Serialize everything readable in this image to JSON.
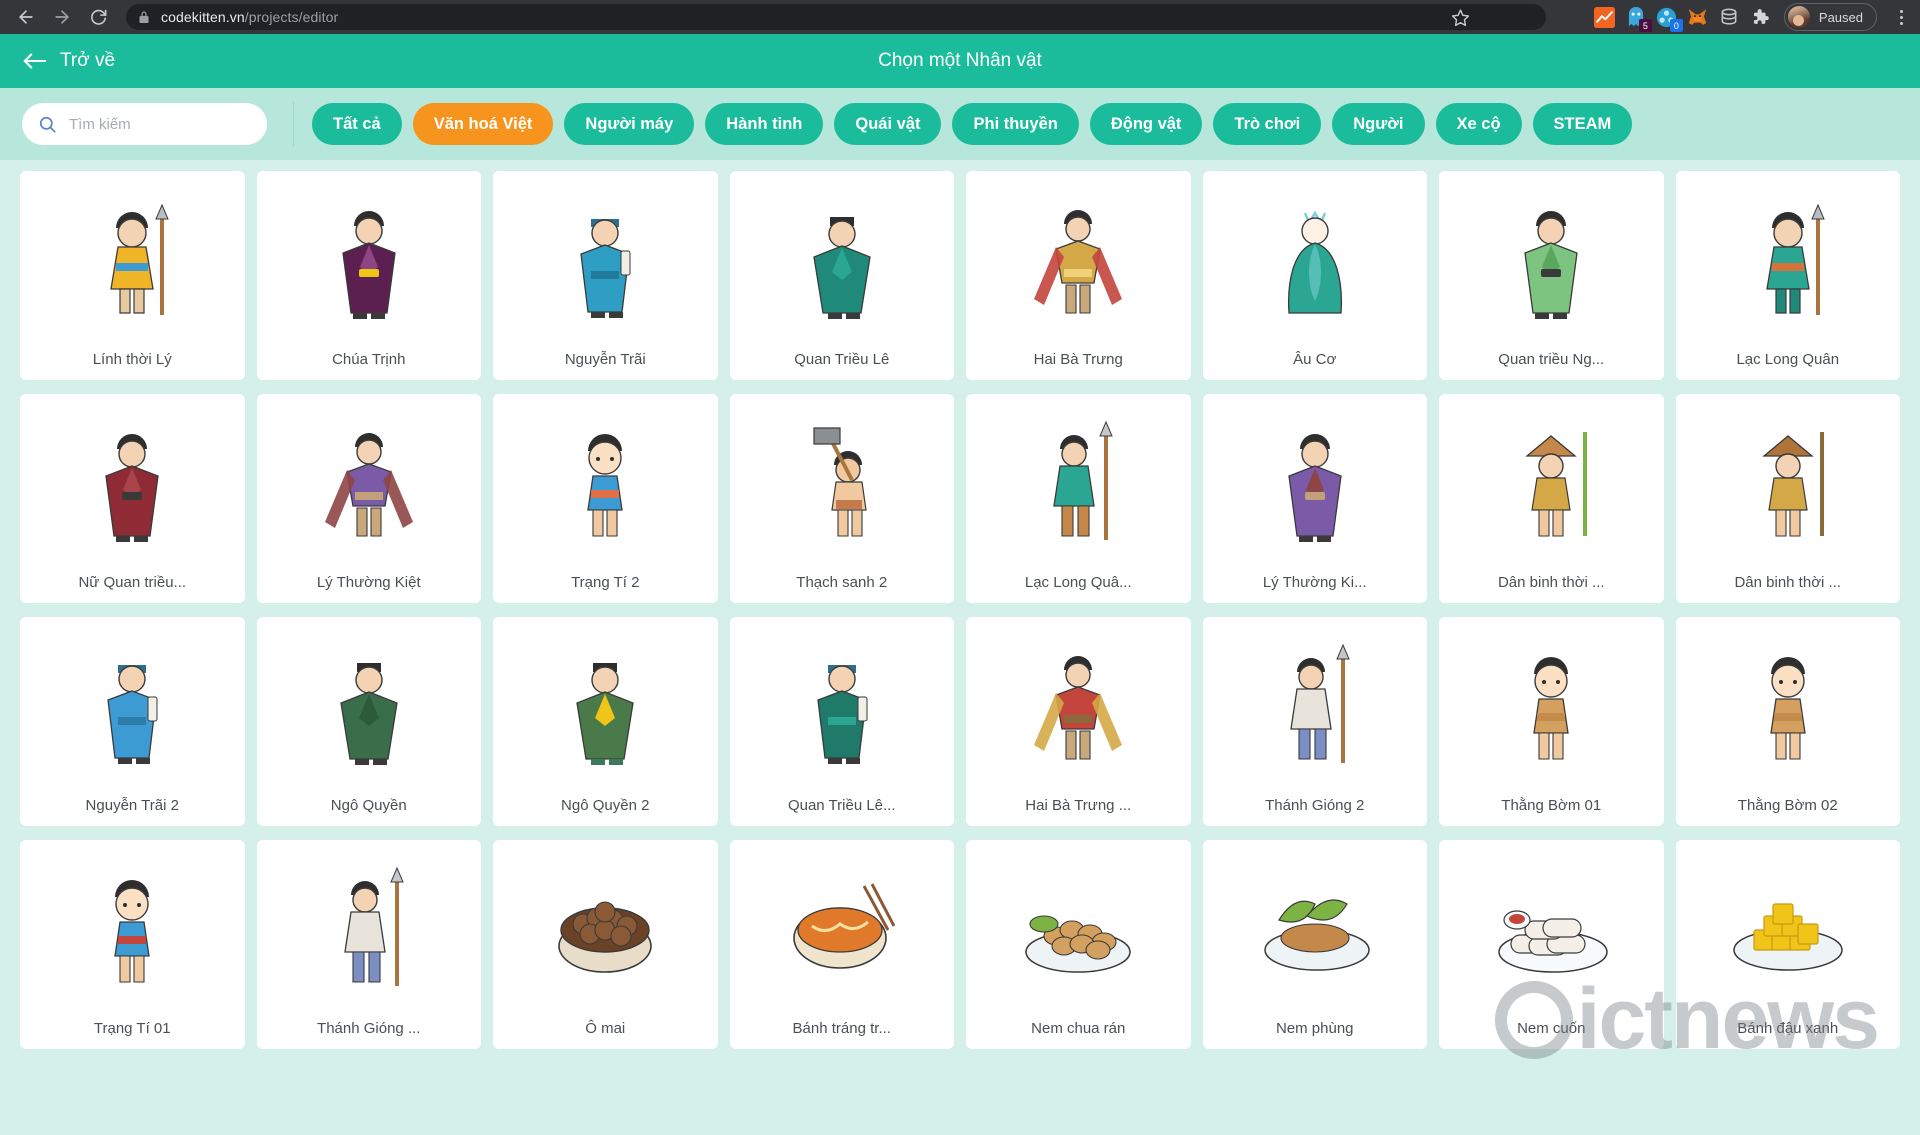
{
  "browser": {
    "url_host": "codekitten.vn",
    "url_path": "/projects/editor",
    "back_icon": "back-arrow-icon",
    "forward_icon": "forward-arrow-icon",
    "reload_icon": "reload-icon",
    "lock_icon": "lock-icon",
    "star_icon": "bookmark-star-icon",
    "profile_label": "Paused",
    "extensions": [
      {
        "name": "analytics-extension-icon",
        "badge": "",
        "color": "#f26522"
      },
      {
        "name": "ghostery-extension-icon",
        "badge": "5",
        "color": "#3aa7dd",
        "badge_color": "#4a0e3f"
      },
      {
        "name": "puzzle-blue-extension-icon",
        "badge": "0",
        "color": "#2a9fd6",
        "badge_color": "#1a73e8"
      },
      {
        "name": "metamask-fox-extension-icon",
        "badge": "",
        "color": "#e2761b"
      },
      {
        "name": "database-extension-icon",
        "badge": "",
        "color": "#b8bcc0"
      },
      {
        "name": "extensions-puzzle-icon",
        "badge": "",
        "color": "#d4d7da"
      }
    ],
    "menu_icon": "three-dot-menu-icon"
  },
  "header": {
    "back_label": "Trở về",
    "back_icon": "arrow-left-icon",
    "title": "Chọn một Nhân vật"
  },
  "toolbar": {
    "search_placeholder": "Tìm kiếm",
    "search_value": "",
    "search_icon": "search-icon",
    "chips": [
      {
        "label": "Tất cả",
        "active": false
      },
      {
        "label": "Văn hoá Việt",
        "active": true
      },
      {
        "label": "Người máy",
        "active": false
      },
      {
        "label": "Hành tinh",
        "active": false
      },
      {
        "label": "Quái vật",
        "active": false
      },
      {
        "label": "Phi thuyền",
        "active": false
      },
      {
        "label": "Động vật",
        "active": false
      },
      {
        "label": "Trò chơi",
        "active": false
      },
      {
        "label": "Người",
        "active": false
      },
      {
        "label": "Xe cộ",
        "active": false
      },
      {
        "label": "STEAM",
        "active": false
      }
    ]
  },
  "colors": {
    "accent_teal": "#1bbc9b",
    "accent_orange": "#f7941e",
    "toolbar_bg": "#b7e6da",
    "page_bg": "#d4f0e8",
    "card_bg": "#ffffff"
  },
  "watermark": "ictnews",
  "grid": {
    "cards": [
      {
        "label": "Lính thời Lý",
        "art": "soldier",
        "c1": "#f0b429",
        "c2": "#3d9bd4",
        "c3": "#e8c9a0"
      },
      {
        "label": "Chúa Trịnh",
        "art": "robe",
        "c1": "#5b2050",
        "c2": "#8e4585",
        "c3": "#f0c419"
      },
      {
        "label": "Nguyễn Trãi",
        "art": "scholar",
        "c1": "#2e9ec4",
        "c2": "#1f7a9c",
        "c3": "#e8c9a0"
      },
      {
        "label": "Quan Triều Lê",
        "art": "official",
        "c1": "#1f8a7a",
        "c2": "#2aa693",
        "c3": "#3a3a3a"
      },
      {
        "label": "Hai Bà Trưng",
        "art": "warrior",
        "c1": "#d4a847",
        "c2": "#c4453c",
        "c3": "#f0d27a"
      },
      {
        "label": "Âu Cơ",
        "art": "queen",
        "c1": "#2aa693",
        "c2": "#1f8a7a",
        "c3": "#7ecfd4"
      },
      {
        "label": "Quan triều Ng...",
        "art": "robe",
        "c1": "#7cc47f",
        "c2": "#5aa85f",
        "c3": "#3a3a3a"
      },
      {
        "label": "Lạc Long Quân",
        "art": "soldier",
        "c1": "#2aa693",
        "c2": "#d4733a",
        "c3": "#1f8a7a"
      },
      {
        "label": "Nữ Quan triều...",
        "art": "robe",
        "c1": "#8e2b34",
        "c2": "#a8444c",
        "c3": "#3a3a3a"
      },
      {
        "label": "Lý Thường Kiệt",
        "art": "warrior",
        "c1": "#7b5ba8",
        "c2": "#8e4545",
        "c3": "#c4a07a"
      },
      {
        "label": "Trạng Tí 2",
        "art": "boy",
        "c1": "#3d9bd4",
        "c2": "#e0704a",
        "c3": "#f0c9a0"
      },
      {
        "label": "Thạch sanh 2",
        "art": "axe",
        "c1": "#c47a4a",
        "c2": "#8a8f94",
        "c3": "#f0c9a0"
      },
      {
        "label": "Lạc Long Quâ...",
        "art": "spear",
        "c1": "#2aa693",
        "c2": "#c4884a",
        "c3": "#d4733a"
      },
      {
        "label": "Lý Thường Ki...",
        "art": "robe",
        "c1": "#7b5ba8",
        "c2": "#8e4545",
        "c3": "#c4a07a"
      },
      {
        "label": "Dân binh thời ...",
        "art": "farmer",
        "c1": "#c4884a",
        "c2": "#7cb342",
        "c3": "#d4a847"
      },
      {
        "label": "Dân binh thời ...",
        "art": "farmer",
        "c1": "#b0743a",
        "c2": "#8a6a3a",
        "c3": "#d4a847"
      },
      {
        "label": "Nguyễn Trãi 2",
        "art": "scholar",
        "c1": "#3d9bd4",
        "c2": "#2e7ca8",
        "c3": "#e8c9a0"
      },
      {
        "label": "Ngô Quyền",
        "art": "official",
        "c1": "#3a6e4a",
        "c2": "#2d5a3a",
        "c3": "#3a3a3a"
      },
      {
        "label": "Ngô Quyền 2",
        "art": "official",
        "c1": "#4a7a4a",
        "c2": "#f0c419",
        "c3": "#3a7a5a"
      },
      {
        "label": "Quan Triều Lê...",
        "art": "scholar",
        "c1": "#1f7a6a",
        "c2": "#2aa693",
        "c3": "#3a3a3a"
      },
      {
        "label": "Hai Bà Trưng ...",
        "art": "warrior",
        "c1": "#c4453c",
        "c2": "#d4a847",
        "c3": "#8a6a3a"
      },
      {
        "label": "Thánh Gióng 2",
        "art": "spear",
        "c1": "#e8e4dc",
        "c2": "#7b8fc4",
        "c3": "#3a3a3a"
      },
      {
        "label": "Thằng Bờm 01",
        "art": "boy",
        "c1": "#d4a060",
        "c2": "#c48a4a",
        "c3": "#f0c9a0"
      },
      {
        "label": "Thằng Bờm 02",
        "art": "boy",
        "c1": "#d4a060",
        "c2": "#c48a4a",
        "c3": "#f0c9a0"
      },
      {
        "label": "Trạng Tí 01",
        "art": "boy",
        "c1": "#3d9bd4",
        "c2": "#c4453c",
        "c3": "#f0c9a0"
      },
      {
        "label": "Thánh Gióng ...",
        "art": "spear",
        "c1": "#e8e4dc",
        "c2": "#7b8fc4",
        "c3": "#3a3a3a"
      },
      {
        "label": "Ô mai",
        "art": "bowl-omai",
        "c1": "#6b4226",
        "c2": "#e8ddc8",
        "c3": "#8a5a36"
      },
      {
        "label": "Bánh tráng tr...",
        "art": "bowl-noodle",
        "c1": "#e07a2a",
        "c2": "#f0e4cc",
        "c3": "#8a5a36"
      },
      {
        "label": "Nem chua rán",
        "art": "plate-nem",
        "c1": "#d4a060",
        "c2": "#7cb342",
        "c3": "#e8ddc8"
      },
      {
        "label": "Nem phùng",
        "art": "plate-leaf",
        "c1": "#7cb342",
        "c2": "#c4884a",
        "c3": "#e8ddc8"
      },
      {
        "label": "Nem cuốn",
        "art": "rolls",
        "c1": "#f4f0e8",
        "c2": "#7cb342",
        "c3": "#c4453c"
      },
      {
        "label": "Bánh đậu xanh",
        "art": "tofu",
        "c1": "#f0c419",
        "c2": "#e8b000",
        "c3": "#e8ddc8"
      }
    ]
  }
}
